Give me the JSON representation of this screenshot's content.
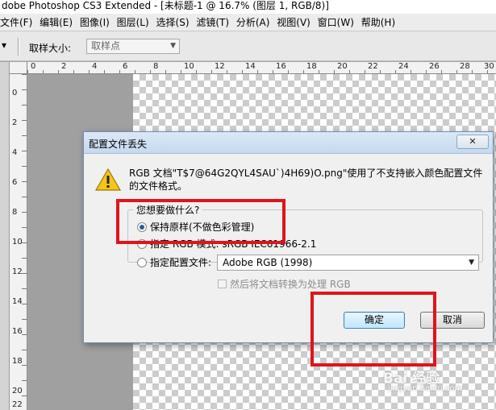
{
  "app": {
    "title": "dobe Photoshop CS3 Extended - [未标题-1 @ 16.7% (图层 1, RGB/8)]"
  },
  "menubar": {
    "items": [
      {
        "label": "文件(F)"
      },
      {
        "label": "编辑(E)"
      },
      {
        "label": "图像(I)"
      },
      {
        "label": "图层(L)"
      },
      {
        "label": "选择(S)"
      },
      {
        "label": "滤镜(T)"
      },
      {
        "label": "分析(A)"
      },
      {
        "label": "视图(V)"
      },
      {
        "label": "窗口(W)"
      },
      {
        "label": "帮助(H)"
      }
    ]
  },
  "options": {
    "tool_arrow": "▾",
    "sample_size_label": "取样大小:",
    "sample_size_value": "取样点"
  },
  "rulers": {
    "top": [
      "0",
      "2",
      "4",
      "6",
      "8",
      "10",
      "12",
      "14",
      "16",
      "18",
      "20",
      "22",
      "24",
      "26",
      "28",
      "30"
    ],
    "left": [
      "0",
      "2",
      "4",
      "6",
      "8",
      "10",
      "12",
      "14",
      "16",
      "18",
      "20",
      "22"
    ]
  },
  "dialog": {
    "title": "配置文件丢失",
    "close_label": "✕",
    "message": "RGB 文档\"T$7@64G2QYL4SAU`)4H69)O.png\"使用了不支持嵌入颜色配置文件的文件格式。",
    "group_label": "您想要做什么?",
    "option_keep": "保持原样(不做色彩管理)",
    "option_rgb": "指定 RGB 模式: sRGB IEC61966-2.1",
    "option_profile": "指定配置文件:",
    "profile_value": "Adobe RGB (1998)",
    "convert_label": "然后将文档转换为处理 RGB",
    "ok_label": "确定",
    "cancel_label": "取消"
  },
  "watermark": {
    "text": "Bai 经验",
    "sub": "jingyan.baidu.com"
  },
  "colors": {
    "highlight_red": "#e0141b",
    "ok_border": "#3c7fb1",
    "radio_dot": "#2d5a9a"
  }
}
